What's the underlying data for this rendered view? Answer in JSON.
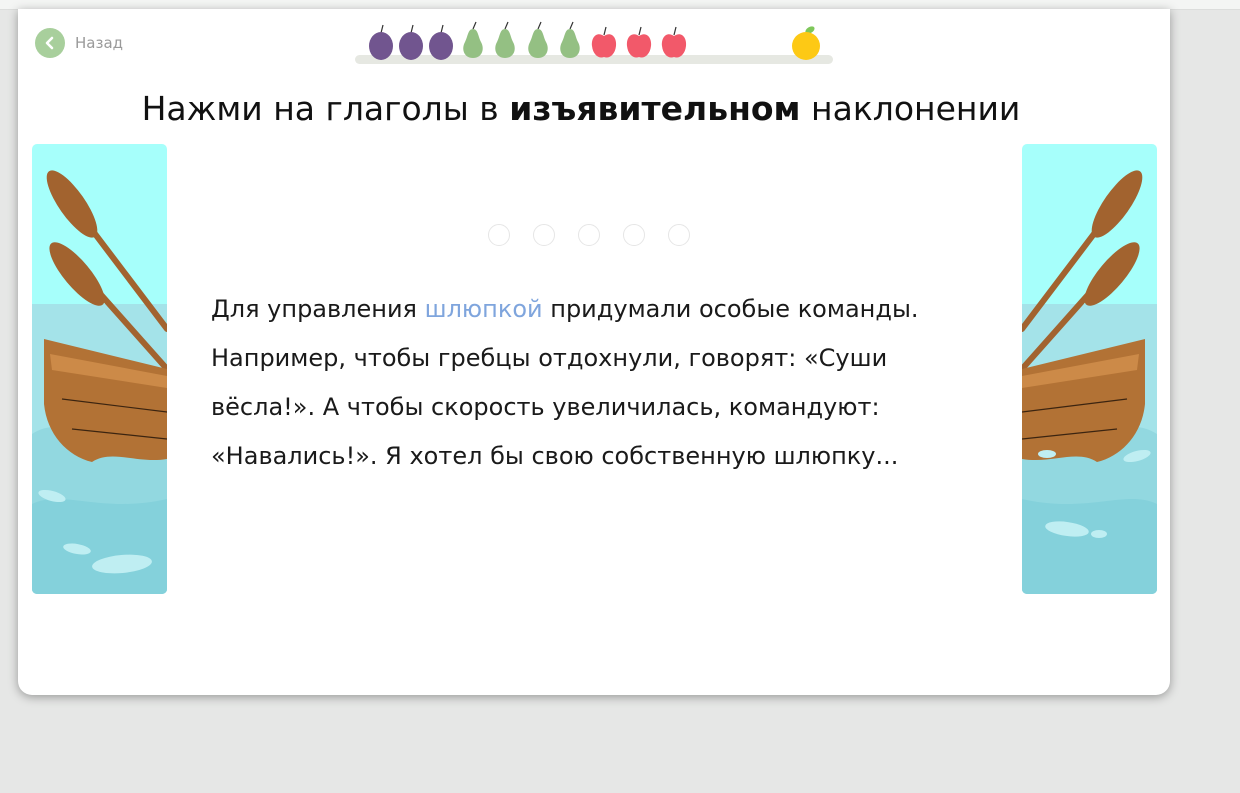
{
  "nav": {
    "back_label": "Назад",
    "back_icon": "chevron-left-icon"
  },
  "progress": {
    "fruits": [
      "plum",
      "plum",
      "plum",
      "pear",
      "pear",
      "pear",
      "pear",
      "apple",
      "apple",
      "apple"
    ],
    "goal_fruit": "orange",
    "colors": {
      "plum": "#71558f",
      "pear": "#94c083",
      "apple": "#f2596a",
      "orange": "#fdc915"
    }
  },
  "task": {
    "title_before": "Нажми на глаголы в ",
    "title_bold": "изъявительном",
    "title_after": " наклонении"
  },
  "steps": {
    "total": 5,
    "done": 0
  },
  "passage": {
    "words": [
      {
        "t": "Для"
      },
      {
        "t": " "
      },
      {
        "t": "управления"
      },
      {
        "t": " "
      },
      {
        "t": "шлюпкой",
        "hl": true
      },
      {
        "t": " "
      },
      {
        "t": "придумали"
      },
      {
        "t": " "
      },
      {
        "t": "особые"
      },
      {
        "t": " "
      },
      {
        "t": "команды."
      },
      {
        "t": " "
      },
      {
        "t": "Например,"
      },
      {
        "t": " "
      },
      {
        "t": "чтобы"
      },
      {
        "t": " "
      },
      {
        "t": "гребцы"
      },
      {
        "t": " "
      },
      {
        "t": "отдохнули,"
      },
      {
        "t": " "
      },
      {
        "t": "говорят:"
      },
      {
        "t": " "
      },
      {
        "t": "«Суши"
      },
      {
        "t": " "
      },
      {
        "t": "вёсла!»."
      },
      {
        "t": " "
      },
      {
        "t": "А"
      },
      {
        "t": " "
      },
      {
        "t": "чтобы"
      },
      {
        "t": " "
      },
      {
        "t": "скорость"
      },
      {
        "t": " "
      },
      {
        "t": "увеличилась,"
      },
      {
        "t": " "
      },
      {
        "t": "командуют:"
      },
      {
        "t": " "
      },
      {
        "t": "«Навались!»."
      },
      {
        "t": " "
      },
      {
        "t": "Я"
      },
      {
        "t": " "
      },
      {
        "t": "хотел"
      },
      {
        "t": " "
      },
      {
        "t": "бы"
      },
      {
        "t": " "
      },
      {
        "t": "свою"
      },
      {
        "t": " "
      },
      {
        "t": "собственную"
      },
      {
        "t": " "
      },
      {
        "t": "шлюпку..."
      }
    ]
  },
  "decor": {
    "sky": "#a6fffb",
    "water": "#a4e3e9",
    "water_deep": "#86d3dc",
    "boat": "#b27235",
    "oar": "#a2632f"
  }
}
